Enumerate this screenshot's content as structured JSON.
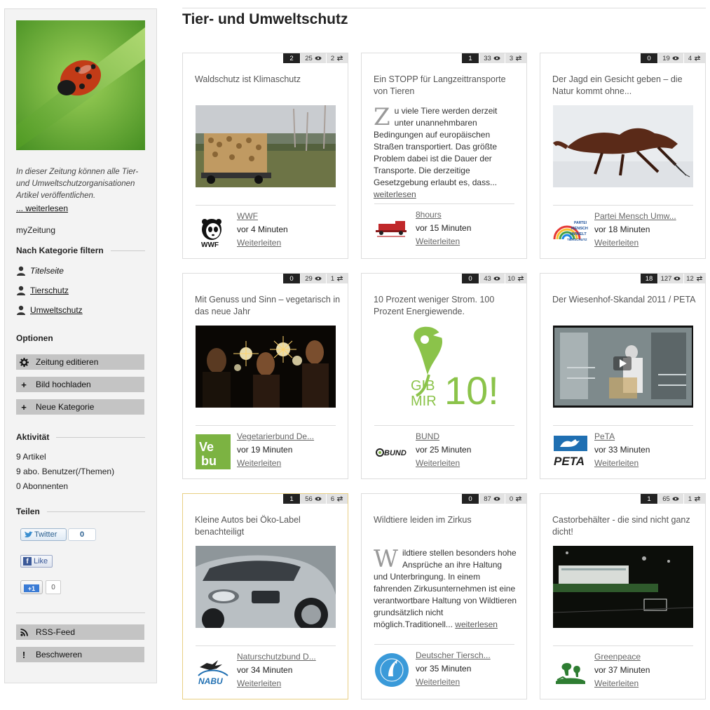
{
  "page": {
    "title": "Tier- und Umweltschutz"
  },
  "sidebar": {
    "intro": "In dieser Zeitung können alle Tier- und Umweltschutzorganisationen Artikel veröffentlichen.",
    "more_link": "... weiterlesen",
    "myzeitung": "myZeitung",
    "filter_title": "Nach Kategorie filtern",
    "categories": [
      {
        "label": "Titelseite",
        "icon": "user-icon"
      },
      {
        "label": "Tierschutz",
        "icon": "user-icon"
      },
      {
        "label": "Umweltschutz",
        "icon": "user-icon"
      }
    ],
    "options_title": "Optionen",
    "options": [
      {
        "label": "Zeitung editieren",
        "icon": "gear-icon"
      },
      {
        "label": "Bild hochladen",
        "icon": "plus-icon"
      },
      {
        "label": "Neue Kategorie",
        "icon": "plus-icon"
      }
    ],
    "activity_title": "Aktivität",
    "activity": [
      "9 Artikel",
      "9 abo. Benutzer(/Themen)",
      "0 Abonnenten"
    ],
    "share_title": "Teilen",
    "share": {
      "twitter_label": "Twitter",
      "twitter_count": "0",
      "facebook_label": "Like",
      "gplus_label": "+1",
      "gplus_count": "0"
    },
    "footer_buttons": [
      {
        "label": "RSS-Feed",
        "icon": "rss-icon"
      },
      {
        "label": "Beschweren",
        "icon": "exclamation-icon"
      }
    ]
  },
  "cards": [
    {
      "comments": "2",
      "views": "25",
      "shares": "2",
      "title": "Waldschutz ist Klimaschutz",
      "image": "timber-truck",
      "source": "WWF",
      "logo": "wwf-logo",
      "time": "vor 4 Minuten",
      "forward": "Weiterleiten"
    },
    {
      "comments": "1",
      "views": "33",
      "shares": "3",
      "title": "Ein STOPP für Langzeittransporte von Tieren",
      "drop": "Z",
      "excerpt": "u viele Tiere werden derzeit unter unannehmbaren Bedingungen auf europäischen Straßen transportiert. Das größte Problem dabei ist die Dauer der Transporte. Die derzeitige Gesetzgebung erlaubt es, dass...",
      "read_more": "weiterlesen",
      "source": "8hours",
      "logo": "8hours-logo",
      "time": "vor 15 Minuten",
      "forward": "Weiterleiten"
    },
    {
      "comments": "0",
      "views": "19",
      "shares": "4",
      "title": "Der Jagd ein Gesicht geben – die Natur kommt ohne...",
      "image": "fox-in-snow",
      "source": "Partei Mensch Umw...",
      "logo": "partei-logo",
      "logo_text": "PARTEI MENSCH UMWELT TIERSCHUTZ",
      "time": "vor 18 Minuten",
      "forward": "Weiterleiten"
    },
    {
      "comments": "0",
      "views": "29",
      "shares": "1",
      "title": "Mit Genuss und Sinn – vegetarisch in das neue Jahr",
      "image": "sparklers",
      "source": "Vegetarierbund De...",
      "logo": "vebu-logo",
      "logo_text": "VEBU",
      "time": "vor 19 Minuten",
      "forward": "Weiterleiten"
    },
    {
      "comments": "0",
      "views": "43",
      "shares": "10",
      "title": "10 Prozent weniger Strom. 100 Prozent Energiewende.",
      "image": "gib-mir-10",
      "image_text_1": "GIB",
      "image_text_2": "MIR",
      "image_text_3": "10!",
      "source": "BUND",
      "logo": "bund-logo",
      "logo_text": "BUND",
      "time": "vor 25 Minuten",
      "forward": "Weiterleiten"
    },
    {
      "comments": "18",
      "views": "127",
      "shares": "12",
      "title": "Der Wiesenhof-Skandal 2011 / PETA",
      "image": "video-still",
      "source": "PeTA",
      "logo": "peta-logo",
      "logo_text": "PETA",
      "time": "vor 33 Minuten",
      "forward": "Weiterleiten"
    },
    {
      "comments": "1",
      "views": "56",
      "shares": "6",
      "title": "Kleine Autos bei Öko-Label benachteiligt",
      "image": "silver-car",
      "source": "Naturschutzbund D...",
      "logo": "nabu-logo",
      "logo_text": "NABU",
      "time": "vor 34 Minuten",
      "forward": "Weiterleiten"
    },
    {
      "comments": "0",
      "views": "87",
      "shares": "0",
      "title": "Wildtiere leiden im Zirkus",
      "drop": "W",
      "excerpt": "ildtiere stellen besonders hohe Ansprüche an ihre Haltung und Unterbringung. In einem fahrenden Zirkusunternehmen ist eine verantwortbare Haltung von Wildtieren grundsätzlich nicht möglich.Traditionell...",
      "read_more": "weiterlesen",
      "source": "Deutscher Tiersch...",
      "logo": "tierschutzbund-logo",
      "time": "vor 35 Minuten",
      "forward": "Weiterleiten"
    },
    {
      "comments": "1",
      "views": "65",
      "shares": "1",
      "title": "Castorbehälter - die sind nicht ganz dicht!",
      "image": "castor-night",
      "source": "Greenpeace",
      "logo": "greenpeace-logo",
      "time": "vor 37 Minuten",
      "forward": "Weiterleiten"
    }
  ]
}
